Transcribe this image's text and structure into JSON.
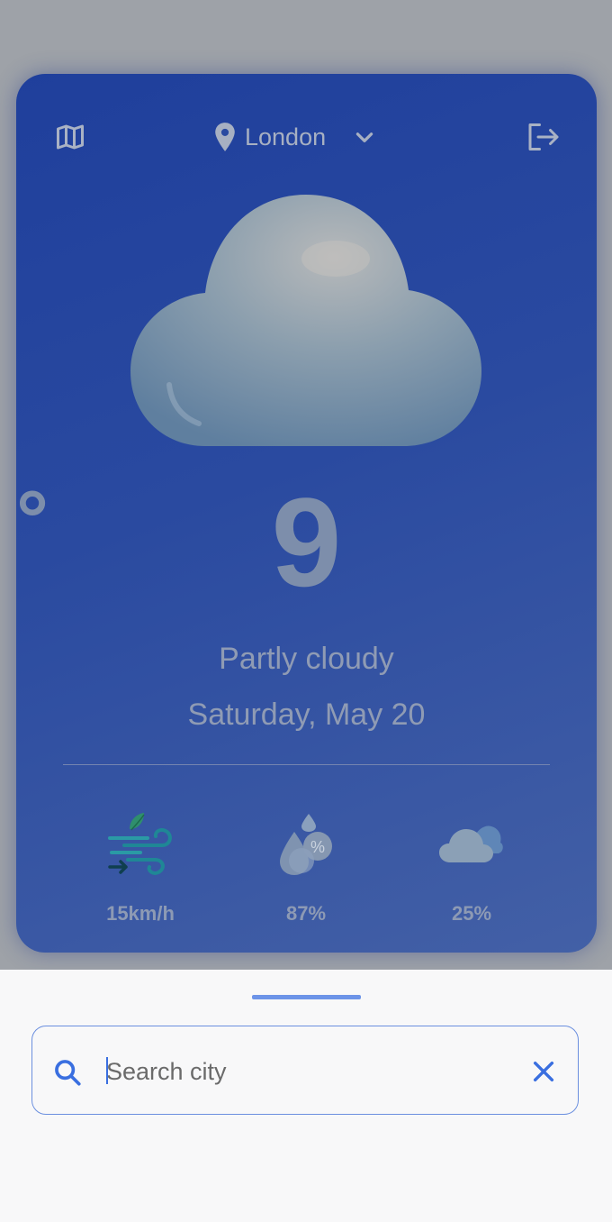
{
  "header": {
    "city": "London",
    "map_icon": "map-icon",
    "logout_icon": "logout-icon",
    "location_icon": "location-pin-icon",
    "dropdown_icon": "chevron-down-icon"
  },
  "weather": {
    "temperature": "9",
    "degree_symbol": "°",
    "condition": "Partly cloudy",
    "date": "Saturday, May 20",
    "icon": "cloud-icon"
  },
  "stats": [
    {
      "icon": "wind-icon",
      "value": "15km/h"
    },
    {
      "icon": "humidity-icon",
      "value": "87%"
    },
    {
      "icon": "cloud-cover-icon",
      "value": "25%"
    }
  ],
  "search": {
    "placeholder": "Search city",
    "value": ""
  },
  "colors": {
    "card_gradient_start": "#1f3f9c",
    "card_gradient_end": "#4360a6",
    "accent": "#6b8fdf",
    "scrim": "#9ea2a8"
  }
}
